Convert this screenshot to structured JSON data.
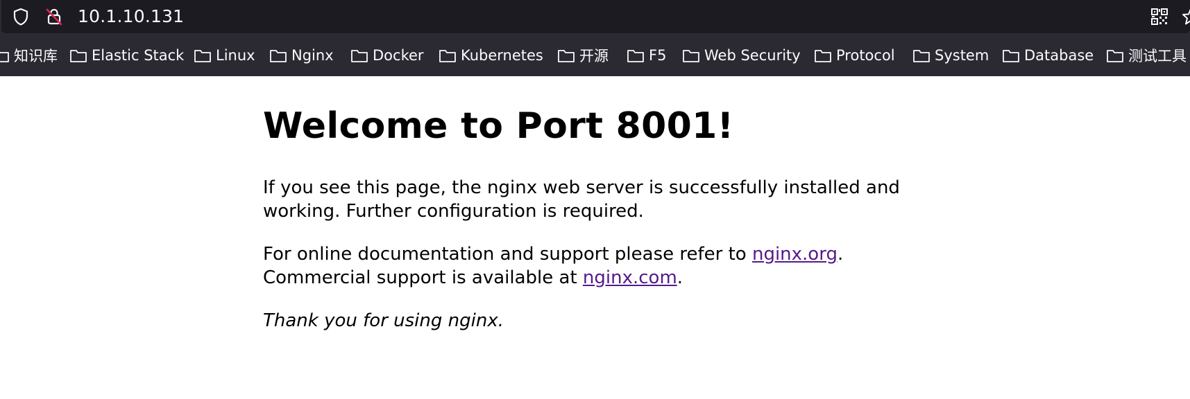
{
  "browser": {
    "url": "10.1.10.131"
  },
  "bookmarks": [
    {
      "label": "知识库"
    },
    {
      "label": "Elastic Stack"
    },
    {
      "label": "Linux"
    },
    {
      "label": "Nginx"
    },
    {
      "label": "Docker"
    },
    {
      "label": "Kubernetes"
    },
    {
      "label": "开源"
    },
    {
      "label": "F5"
    },
    {
      "label": "Web Security"
    },
    {
      "label": "Protocol"
    },
    {
      "label": "System"
    },
    {
      "label": "Database"
    },
    {
      "label": "测试工具"
    }
  ],
  "page": {
    "heading": "Welcome to Port 8001!",
    "para1_line1": "If you see this page, the nginx web server is successfully installed and",
    "para1_line2": "working. Further configuration is required.",
    "para2_line1_prefix": "For online documentation and support please refer to ",
    "para2_link1": "nginx.org",
    "para2_line1_suffix": ".",
    "para2_line2_prefix": "Commercial support is available at ",
    "para2_link2": "nginx.com",
    "para2_line2_suffix": ".",
    "thanks": "Thank you for using nginx."
  },
  "colors": {
    "chrome_dark": "#1c1b22",
    "bookmark_bar": "#2b2a33",
    "chrome_text": "#fbfbfe",
    "link": "#551a8b"
  }
}
